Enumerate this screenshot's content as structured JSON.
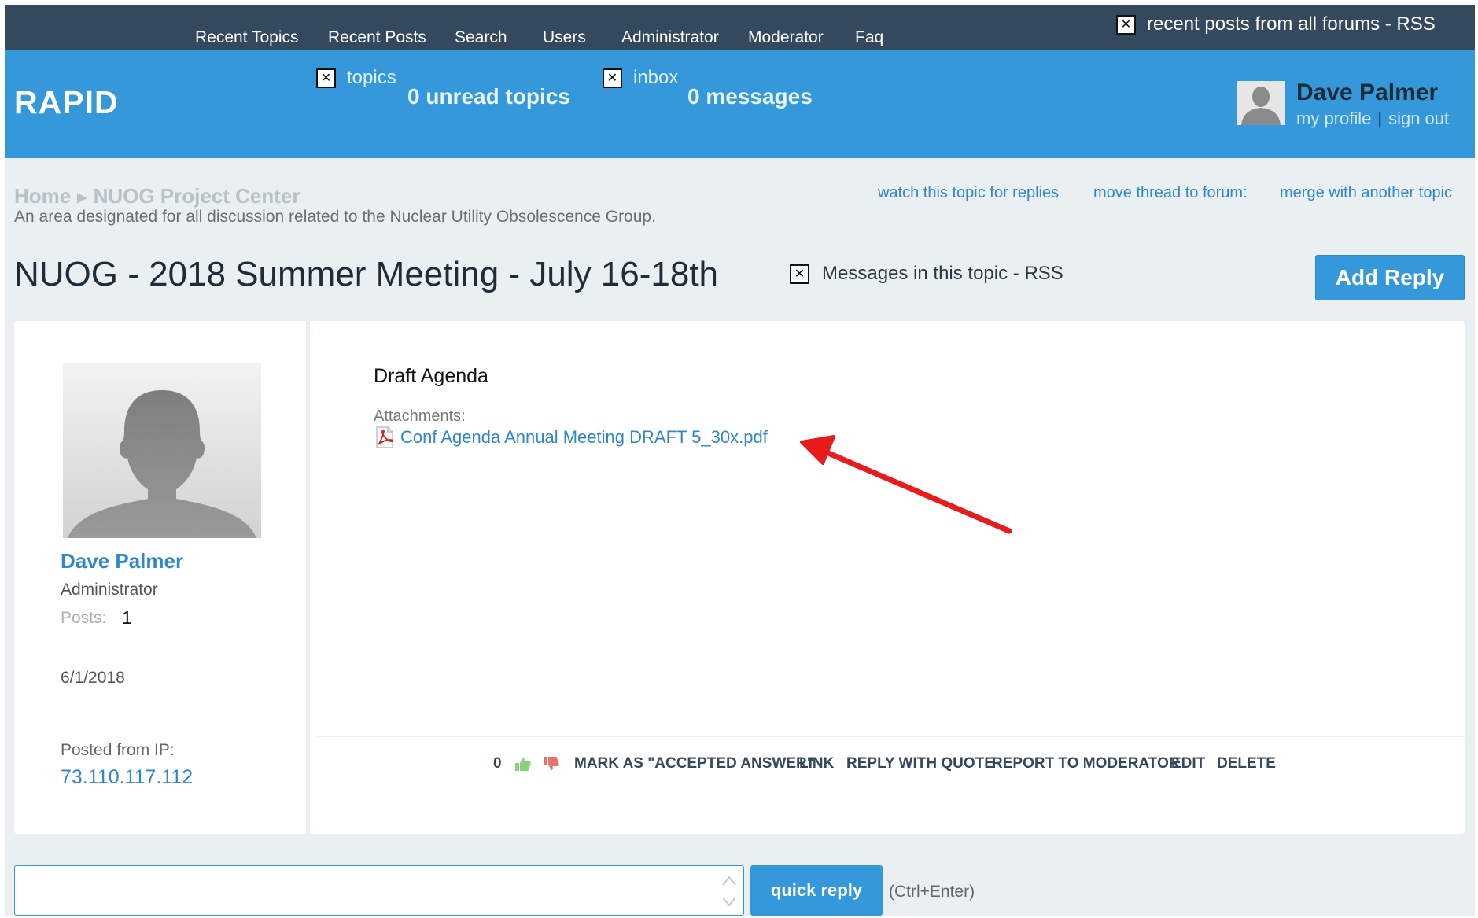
{
  "topnav": {
    "items": [
      "Recent Topics",
      "Recent Posts",
      "Search",
      "Users",
      "Administrator",
      "Moderator",
      "Faq"
    ],
    "rss_label": "recent posts from all forums - RSS"
  },
  "header": {
    "brand": "RAPID",
    "topics_label": "topics",
    "unread_topics": "0 unread topics",
    "inbox_label": "inbox",
    "messages": "0 messages",
    "user_name": "Dave Palmer",
    "my_profile": "my profile",
    "sign_out": "sign out"
  },
  "breadcrumb": {
    "home": "Home",
    "forum": "NUOG Project Center",
    "description": "An area designated for all discussion related to the Nuclear Utility Obsolescence Group."
  },
  "topic_actions": {
    "watch": "watch this topic for replies",
    "move": "move thread to forum:",
    "merge": "merge with another topic"
  },
  "topic": {
    "title": "NUOG - 2018 Summer Meeting - July 16-18th",
    "rss_label": "Messages in this topic - RSS",
    "add_reply": "Add Reply"
  },
  "post": {
    "author": "Dave Palmer",
    "role": "Administrator",
    "posts_label": "Posts:",
    "posts_count": "1",
    "date": "6/1/2018",
    "ip_label": "Posted from IP:",
    "ip": "73.110.117.112",
    "body": "Draft Agenda",
    "attachments_label": "Attachments:",
    "attachment_name": "Conf Agenda Annual Meeting DRAFT 5_30x.pdf",
    "vote_count": "0",
    "actions": {
      "accept": "MARK AS \"ACCEPTED ANSWER\"",
      "link": "LINK",
      "quote": "REPLY WITH QUOTE",
      "report": "REPORT TO MODERATOR",
      "edit": "EDIT",
      "delete": "DELETE"
    }
  },
  "quick_reply": {
    "button": "quick reply",
    "hint": "(Ctrl+Enter)"
  },
  "colors": {
    "topnav_bg": "#34495e",
    "header_bg": "#3498db",
    "page_bg": "#eaeff1",
    "link": "#2e87cc",
    "annotation_arrow": "#e81c1c"
  }
}
